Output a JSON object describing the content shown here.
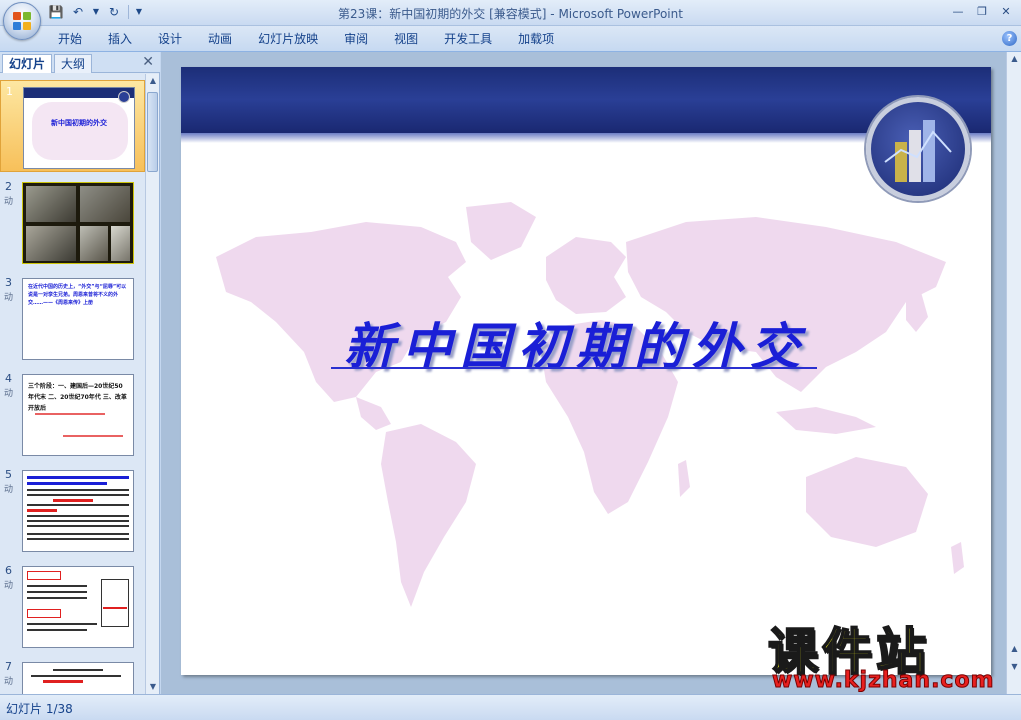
{
  "window": {
    "title": "第23课：新中国初期的外交 [兼容模式] - Microsoft PowerPoint"
  },
  "ribbon": {
    "tabs": [
      "开始",
      "插入",
      "设计",
      "动画",
      "幻灯片放映",
      "审阅",
      "视图",
      "开发工具",
      "加载项"
    ]
  },
  "panel": {
    "tabs": [
      "幻灯片",
      "大纲"
    ],
    "close_icon": "close-icon",
    "slides": [
      {
        "num": "1",
        "selected": true,
        "preview_text": "新中国初期的外交"
      },
      {
        "num": "2",
        "anim": "动"
      },
      {
        "num": "3",
        "anim": "动",
        "preview_text": "在近代中国的历史上，“外交”与“屈辱”可以说是一对孪生兄弟。周恩来曾将不义的外交……——《周恩来传》上册"
      },
      {
        "num": "4",
        "anim": "动",
        "preview_text": "三个阶段：一、建国后—20世纪50年代末 二、20世纪70年代 三、改革开放后"
      },
      {
        "num": "5",
        "anim": "动"
      },
      {
        "num": "6",
        "anim": "动"
      },
      {
        "num": "7",
        "anim": "动"
      }
    ]
  },
  "slide": {
    "title": "新中国初期的外交"
  },
  "watermark": {
    "main": "课件站",
    "url": "www.kjzhan.com"
  },
  "status": {
    "slide_indicator": "幻灯片 1/38"
  },
  "colors": {
    "title_blue": "#1a1fd6",
    "header_navy": "#1c2e78",
    "map_pink": "#efd9ee",
    "selected_thumb": "#f7c05a"
  }
}
